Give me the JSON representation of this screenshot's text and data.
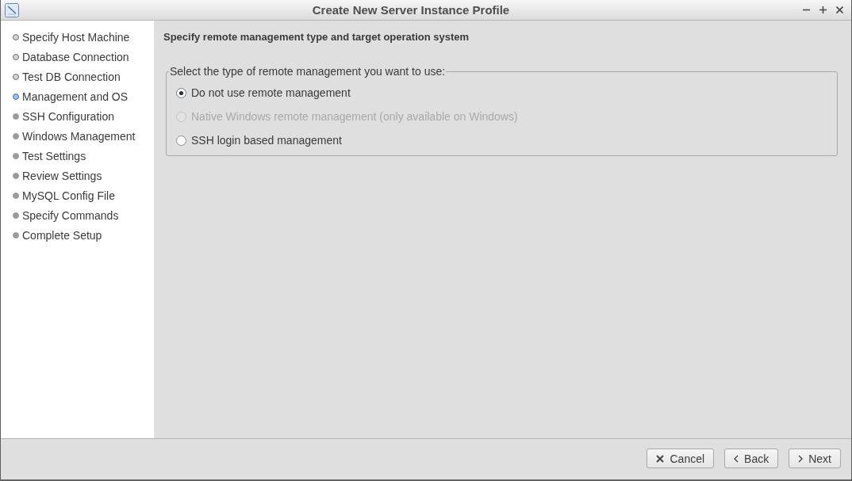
{
  "window": {
    "title": "Create New Server Instance Profile"
  },
  "steps": [
    {
      "label": "Specify Host Machine",
      "done": true,
      "selected": false
    },
    {
      "label": "Database Connection",
      "done": true,
      "selected": false
    },
    {
      "label": "Test DB Connection",
      "done": true,
      "selected": false
    },
    {
      "label": "Management and OS",
      "done": false,
      "selected": true
    },
    {
      "label": "SSH Configuration",
      "done": false,
      "selected": false
    },
    {
      "label": "Windows Management",
      "done": false,
      "selected": false
    },
    {
      "label": "Test Settings",
      "done": false,
      "selected": false
    },
    {
      "label": "Review Settings",
      "done": false,
      "selected": false
    },
    {
      "label": "MySQL Config File",
      "done": false,
      "selected": false
    },
    {
      "label": "Specify Commands",
      "done": false,
      "selected": false
    },
    {
      "label": "Complete Setup",
      "done": false,
      "selected": false
    }
  ],
  "page": {
    "heading": "Specify remote management type and target operation system",
    "management": {
      "label": "Select the type of remote management you want to use:",
      "options": [
        {
          "label": "Do not use remote management",
          "selected": true,
          "disabled": false
        },
        {
          "label": "Native Windows remote management (only available on Windows)",
          "selected": false,
          "disabled": true
        },
        {
          "label": "SSH login based management",
          "selected": false,
          "disabled": false
        }
      ]
    }
  },
  "buttons": [
    {
      "label": "Cancel",
      "kind": "cancel"
    },
    {
      "label": "Back",
      "kind": "back"
    },
    {
      "label": "Next",
      "kind": "next"
    }
  ]
}
